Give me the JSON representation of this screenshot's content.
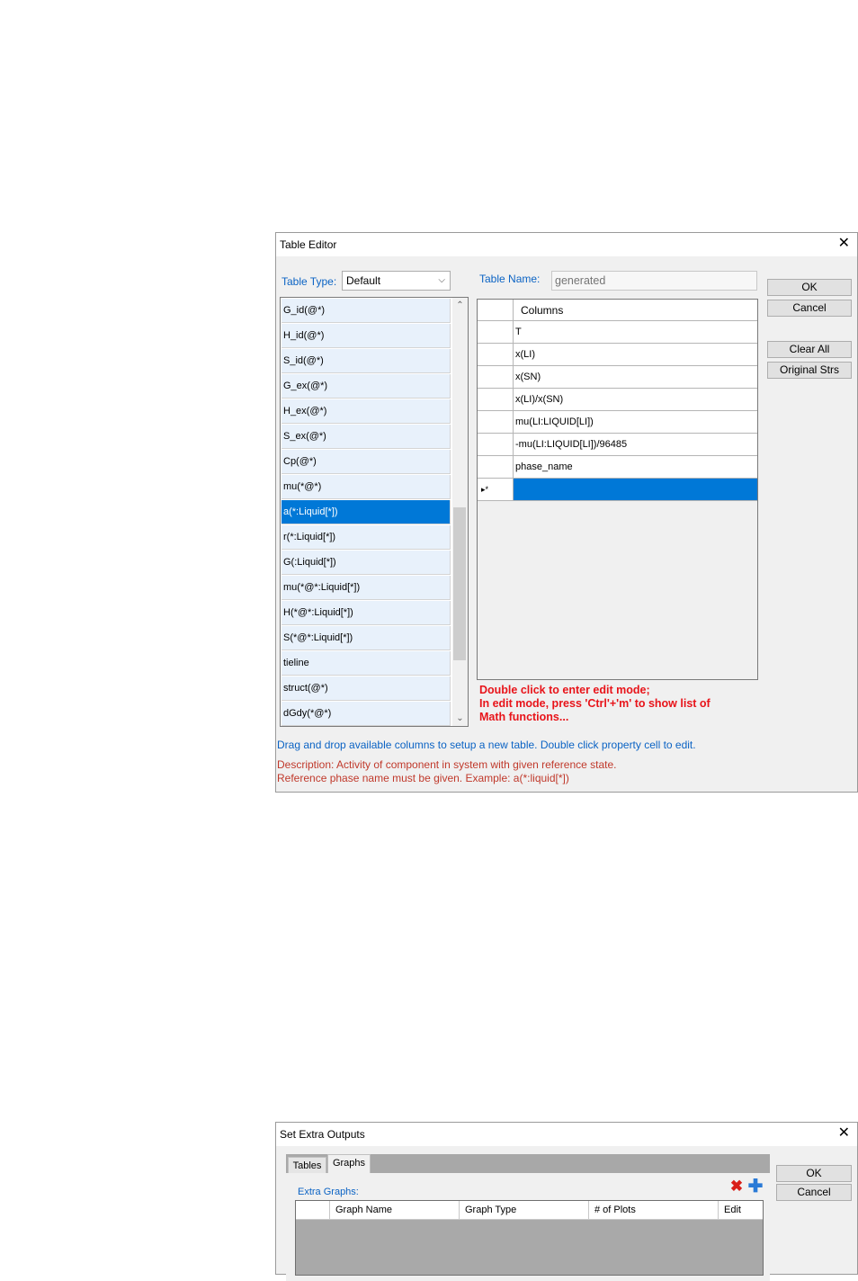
{
  "table_editor": {
    "title": "Table Editor",
    "table_type_label": "Table Type:",
    "table_type_value": "Default",
    "table_name_label": "Table Name:",
    "table_name_placeholder": "generated",
    "buttons": {
      "ok": "OK",
      "cancel": "Cancel",
      "clear_all": "Clear All",
      "original_strs": "Original Strs"
    },
    "available": [
      "G_id(@*)",
      "H_id(@*)",
      "S_id(@*)",
      "G_ex(@*)",
      "H_ex(@*)",
      "S_ex(@*)",
      "Cp(@*)",
      "mu(*@*)",
      "a(*:Liquid[*])",
      "r(*:Liquid[*])",
      "G(:Liquid[*])",
      "mu(*@*:Liquid[*])",
      "H(*@*:Liquid[*])",
      "S(*@*:Liquid[*])",
      "tieline",
      "struct(@*)",
      "dGdy(*@*)"
    ],
    "selected_index": 8,
    "columns_header": "Columns",
    "columns": [
      "T",
      "x(LI)",
      "x(SN)",
      "x(LI)/x(SN)",
      "mu(LI:LIQUID[LI])",
      "-mu(LI:LIQUID[LI])/96485",
      "phase_name"
    ],
    "new_row_marker": "▸*",
    "edit_note": [
      "Double click to enter edit mode;",
      "In edit mode, press 'Ctrl'+'m' to show list of",
      "Math functions..."
    ],
    "drag_hint": "Drag and drop available columns to setup a new table. Double click property cell to edit.",
    "description": "Description: Activity of component in system with given reference state.",
    "reference_note": "Reference phase name must be given. Example: a(*:liquid[*])",
    "colors": {
      "accent": "#0078d7",
      "label_blue": "#0b63c4",
      "note_red": "#e8141a",
      "desc_red": "#c0392b"
    }
  },
  "extra_outputs": {
    "title": "Set Extra Outputs",
    "tabs": [
      "Tables",
      "Graphs"
    ],
    "active_tab": "Graphs",
    "extra_graphs_label": "Extra Graphs:",
    "columns": [
      "Graph Name",
      "Graph Type",
      "# of Plots",
      "Edit"
    ],
    "buttons": {
      "ok": "OK",
      "cancel": "Cancel"
    },
    "icons": {
      "delete": "red-x-icon",
      "add": "blue-plus-icon"
    }
  }
}
